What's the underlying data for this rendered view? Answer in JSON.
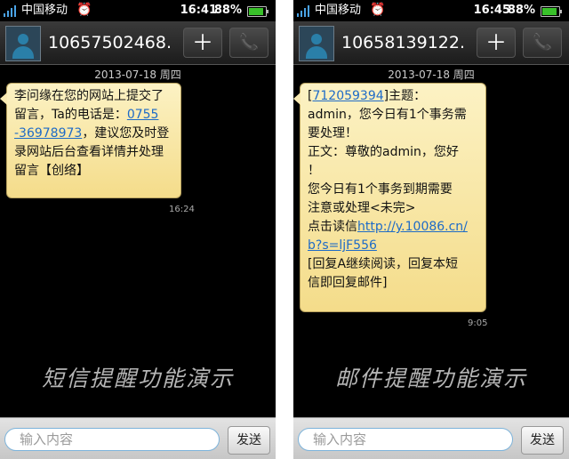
{
  "screens": [
    {
      "carrier": "中国移动",
      "time": "16:41",
      "battery_percent": "88%",
      "battery_level": 0.88,
      "contact": "10657502468.",
      "date": "2013-07-18 周四",
      "message_lines": [
        {
          "pre": "李问缘在您的网站上提交了",
          "link": "",
          "post": ""
        },
        {
          "pre": "留言，Ta的电话是：",
          "link": "0755",
          "post": ""
        },
        {
          "pre": "",
          "link": "-36978973",
          "post": "，建议您及时登"
        },
        {
          "pre": "录网站后台查看详情并处理",
          "link": "",
          "post": ""
        },
        {
          "pre": "留言【创络】",
          "link": "",
          "post": ""
        }
      ],
      "message_time": "16:24",
      "caption": "短信提醒功能演示",
      "input_placeholder": "输入内容",
      "send_label": "发送"
    },
    {
      "carrier": "中国移动",
      "time": "16:45",
      "battery_percent": "88%",
      "battery_level": 0.88,
      "contact": "10658139122.",
      "date": "2013-07-18 周四",
      "message_lines": [
        {
          "pre": "[",
          "link": "712059394",
          "post": "]主题："
        },
        {
          "pre": "admin，您今日有1个事务需",
          "link": "",
          "post": ""
        },
        {
          "pre": "要处理！",
          "link": "",
          "post": ""
        },
        {
          "pre": "正文：尊敬的admin，您好",
          "link": "",
          "post": ""
        },
        {
          "pre": "！",
          "link": "",
          "post": ""
        },
        {
          "pre": "您今日有1个事务到期需要",
          "link": "",
          "post": ""
        },
        {
          "pre": "注意或处理<未完>",
          "link": "",
          "post": ""
        },
        {
          "pre": "点击读信",
          "link": "http://y.10086.cn/",
          "post": ""
        },
        {
          "pre": "",
          "link": "b?s=ljF556",
          "post": ""
        },
        {
          "pre": "[回复A继续阅读，回复本短",
          "link": "",
          "post": ""
        },
        {
          "pre": "信即回复邮件]",
          "link": "",
          "post": ""
        }
      ],
      "message_time": "9:05",
      "caption": "邮件提醒功能演示",
      "input_placeholder": "输入内容",
      "send_label": "发送"
    }
  ],
  "icons": {
    "signal": "signal-bars-icon",
    "alarm": "alarm-clock-icon",
    "battery": "battery-icon",
    "avatar": "contact-avatar-icon",
    "add": "plus-icon",
    "call": "phone-icon"
  },
  "colors": {
    "bubble": "#f6e39a",
    "link": "#1e6bc7",
    "battery_fill": "#39c12a",
    "signal": "#4aa3e6"
  }
}
